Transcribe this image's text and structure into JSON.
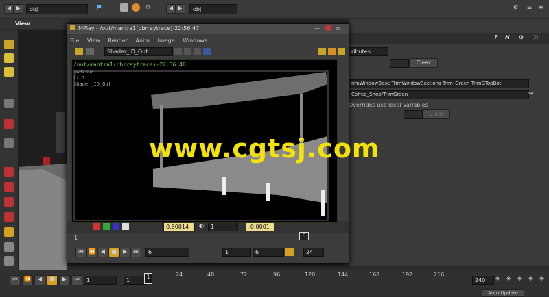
{
  "topbar": {
    "left_path": "obj",
    "right_path": "obj"
  },
  "viewport": {
    "label": "View"
  },
  "mplay": {
    "title": "MPlay - /out/mantra1(pbrraytrace)-22:56:47",
    "menu": [
      "File",
      "View",
      "Render",
      "Anim",
      "Image",
      "Windows"
    ],
    "channel": "Shader_ID_Out",
    "info_line1": "/out/mantra1(pbrraytrace)-22:56:48",
    "info_line2": "640x360",
    "info_line3": "fr 1",
    "info_line4": "Shader_ID_Out",
    "gamma": "0.50014",
    "exposure": "1",
    "offset": "-0.0001",
    "frame_marker": "6",
    "frame_field": "6",
    "start_field": "1",
    "current_field": "6",
    "end_field": "24",
    "fps_ruler": "1"
  },
  "params": {
    "attributes_label": "ributes",
    "clear_label": "Clear",
    "trim_line": "rimWindowBase TrimWindowSections Trim_Green TrimGTopBot",
    "shop_path": "Coffee_Shop/TrimGreen",
    "overrides_label": "Overrides use local variables",
    "clear2_label": "Clear"
  },
  "timeline": {
    "frame_start": "1",
    "frame_step": "1",
    "ticks": [
      "24",
      "48",
      "72",
      "96",
      "120",
      "144",
      "168",
      "192",
      "216"
    ],
    "current": "1",
    "end": "240",
    "auto_update": "Auto Update"
  },
  "watermark": "www.cgtsj.com",
  "colors": {
    "accent_yellow": "#f3e20a",
    "field_yellow": "#ecdc8c",
    "panel_bg": "#3c3c3c"
  }
}
